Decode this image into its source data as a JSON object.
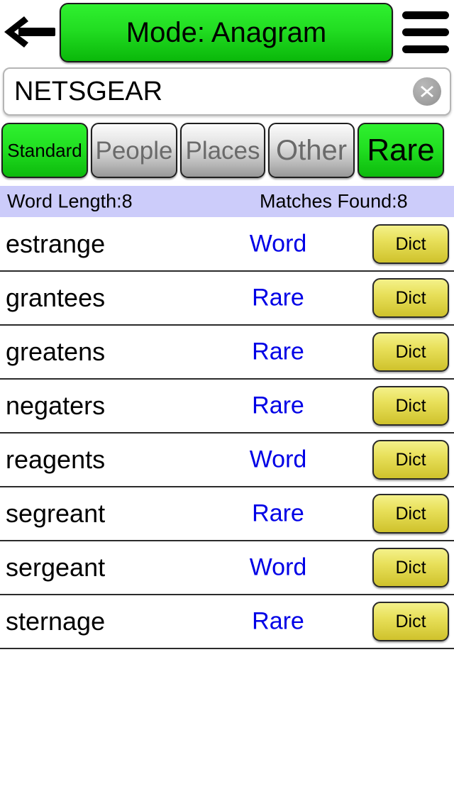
{
  "header": {
    "back_icon": "back-arrow-icon",
    "mode_label": "Mode: Anagram",
    "menu_icon": "hamburger-menu-icon"
  },
  "search": {
    "value": "NETSGEAR",
    "placeholder": "",
    "clear_icon": "clear-circle-x-icon"
  },
  "filters": [
    {
      "label": "Standard",
      "active": true
    },
    {
      "label": "People",
      "active": false
    },
    {
      "label": "Places",
      "active": false
    },
    {
      "label": "Other",
      "active": false
    },
    {
      "label": "Rare",
      "active": true
    }
  ],
  "status": {
    "word_length": "Word Length:8",
    "matches_found": "Matches Found:8"
  },
  "results": {
    "action_label": "Dict",
    "rows": [
      {
        "word": "estrange",
        "type": "Word"
      },
      {
        "word": "grantees",
        "type": "Rare"
      },
      {
        "word": "greatens",
        "type": "Rare"
      },
      {
        "word": "negaters",
        "type": "Rare"
      },
      {
        "word": "reagents",
        "type": "Word"
      },
      {
        "word": "segreant",
        "type": "Rare"
      },
      {
        "word": "sergeant",
        "type": "Word"
      },
      {
        "word": "sternage",
        "type": "Rare"
      }
    ]
  },
  "colors": {
    "active_green": "#22dd22",
    "inactive_gray": "#bdbdbd",
    "status_lavender": "#ccccfa",
    "type_blue": "#0000e6",
    "dict_yellow": "#e8e05a"
  }
}
